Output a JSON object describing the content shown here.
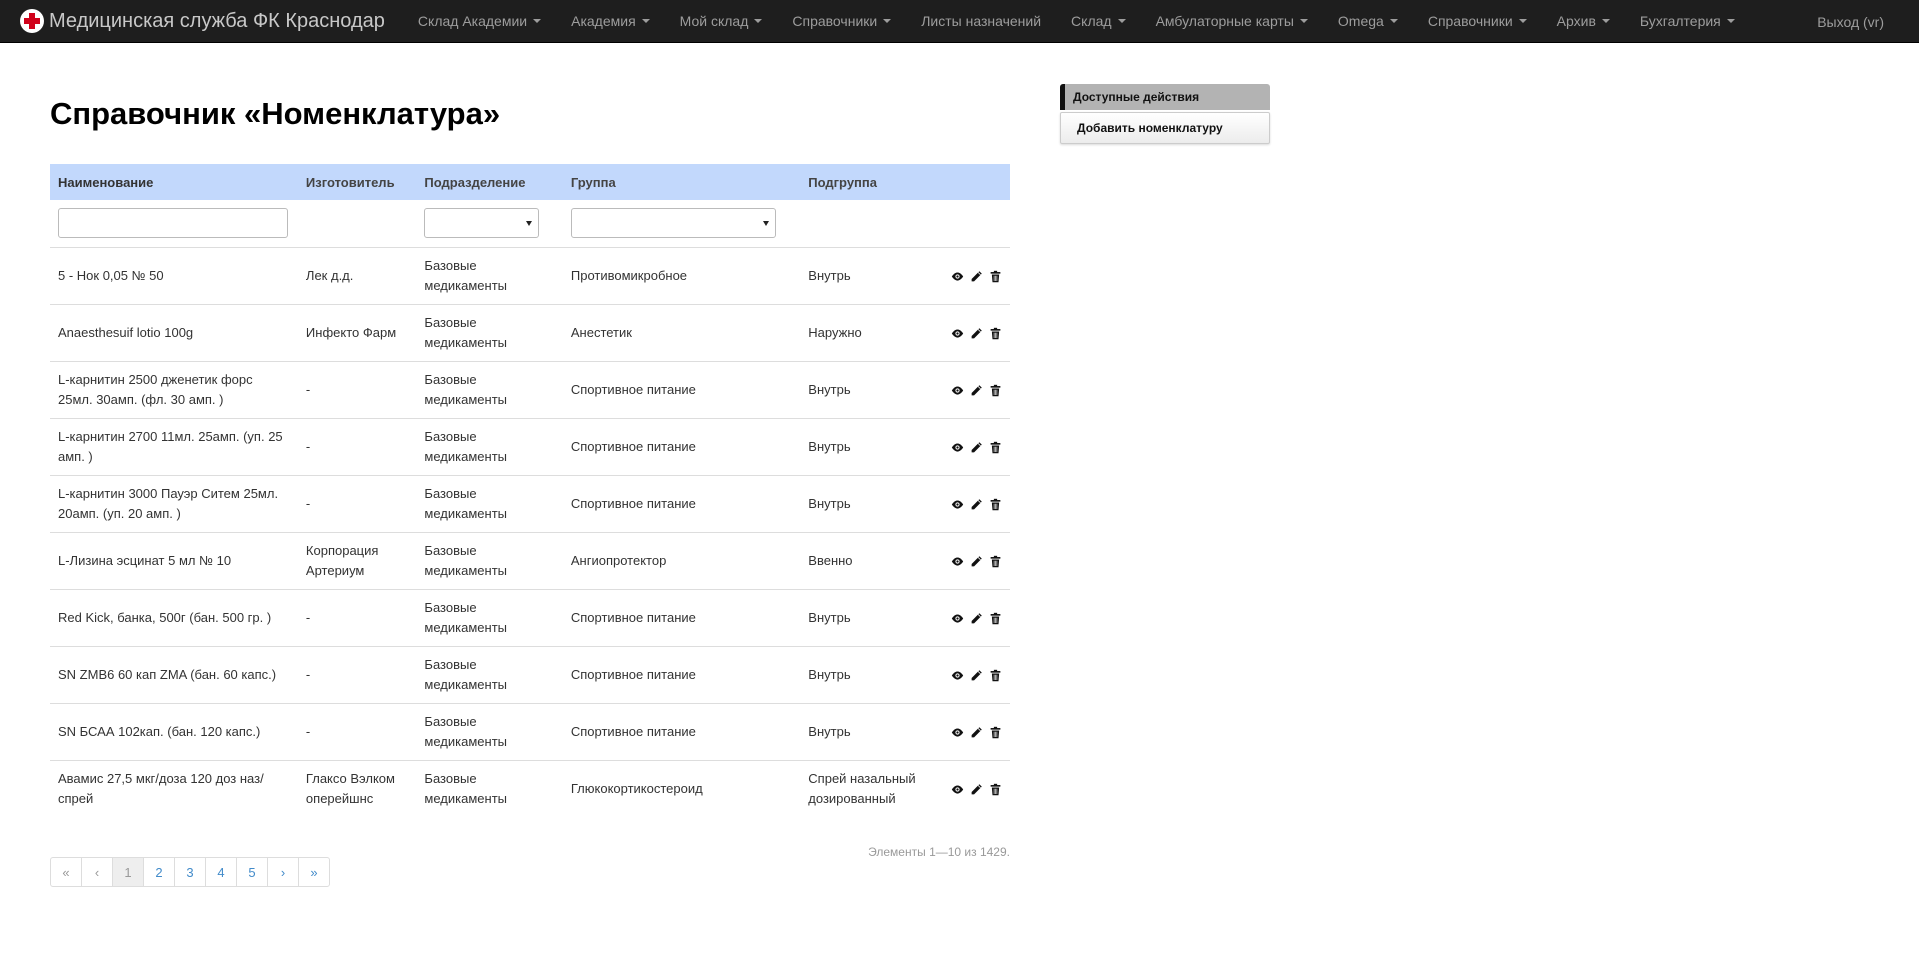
{
  "navbar": {
    "brand": "Медицинская служба ФК Краснодар",
    "items": [
      {
        "label": "Склад Академии",
        "dropdown": true
      },
      {
        "label": "Академия",
        "dropdown": true
      },
      {
        "label": "Мой склад",
        "dropdown": true
      },
      {
        "label": "Справочники",
        "dropdown": true
      },
      {
        "label": "Листы назначений",
        "dropdown": false
      },
      {
        "label": "Склад",
        "dropdown": true
      },
      {
        "label": "Амбулаторные карты",
        "dropdown": true
      },
      {
        "label": "Omega",
        "dropdown": true
      },
      {
        "label": "Справочники",
        "dropdown": true
      },
      {
        "label": "Архив",
        "dropdown": true
      },
      {
        "label": "Бухгалтерия",
        "dropdown": true
      }
    ],
    "logout": "Выход (vr)"
  },
  "page": {
    "title": "Справочник «Номенклатура»"
  },
  "table": {
    "headers": {
      "name": "Наименование",
      "maker": "Изготовитель",
      "dept": "Подразделение",
      "group": "Группа",
      "subgroup": "Подгруппа"
    },
    "rows": [
      {
        "name": "5 - Нок 0,05 № 50",
        "maker": "Лек д.д.",
        "dept": "Базовые медикаменты",
        "group": "Противомикробное",
        "subgroup": "Внутрь"
      },
      {
        "name": "Anaesthesuif lotio 100g",
        "maker": "Инфекто Фарм",
        "dept": "Базовые медикаменты",
        "group": "Анестетик",
        "subgroup": "Наружно"
      },
      {
        "name": "L-карнитин 2500 дженетик форс 25мл. 30амп. (фл. 30 амп. )",
        "maker": "-",
        "dept": "Базовые медикаменты",
        "group": "Спортивное питание",
        "subgroup": "Внутрь"
      },
      {
        "name": "L-карнитин 2700 11мл. 25амп. (уп. 25 амп. )",
        "maker": "-",
        "dept": "Базовые медикаменты",
        "group": "Спортивное питание",
        "subgroup": "Внутрь"
      },
      {
        "name": "L-карнитин 3000 Пауэр Ситем 25мл. 20амп. (уп. 20 амп. )",
        "maker": "-",
        "dept": "Базовые медикаменты",
        "group": "Спортивное питание",
        "subgroup": "Внутрь"
      },
      {
        "name": "L-Лизина эсцинат 5 мл № 10",
        "maker": "Корпорация Артериум",
        "dept": "Базовые медикаменты",
        "group": "Ангиопротектор",
        "subgroup": "Ввенно"
      },
      {
        "name": "Red Kick, банка, 500г (бан. 500 гр. )",
        "maker": "-",
        "dept": "Базовые медикаменты",
        "group": "Спортивное питание",
        "subgroup": "Внутрь"
      },
      {
        "name": "SN ZMB6 60 кап ZMA (бан. 60 капс.)",
        "maker": "-",
        "dept": "Базовые медикаменты",
        "group": "Спортивное питание",
        "subgroup": "Внутрь"
      },
      {
        "name": "SN БСАА 102кап. (бан. 120 капс.)",
        "maker": "-",
        "dept": "Базовые медикаменты",
        "group": "Спортивное питание",
        "subgroup": "Внутрь"
      },
      {
        "name": "Авамис 27,5 мкг/доза 120 доз наз/спрей",
        "maker": "Глаксо Вэлком оперейшнс",
        "dept": "Базовые медикаменты",
        "group": "Глюкокортикостероид",
        "subgroup": "Спрей назальный дозированный"
      }
    ],
    "icons": {
      "view": "eye-icon",
      "edit": "pencil-icon",
      "delete": "trash-icon"
    }
  },
  "pagination": {
    "counter": "Элементы 1—10 из 1429.",
    "first": "«",
    "prev": "‹",
    "pages": [
      "1",
      "2",
      "3",
      "4",
      "5"
    ],
    "current": "1",
    "next": "›",
    "last": "»"
  },
  "sidebar": {
    "heading": "Доступные действия",
    "add_button": "Добавить номенклатуру"
  },
  "colors": {
    "navbar_bg": "#1e1e1e",
    "table_header_bg": "#c2d8fc",
    "link": "#428bca",
    "sidebar_heading_bg": "#b3b3b3"
  }
}
